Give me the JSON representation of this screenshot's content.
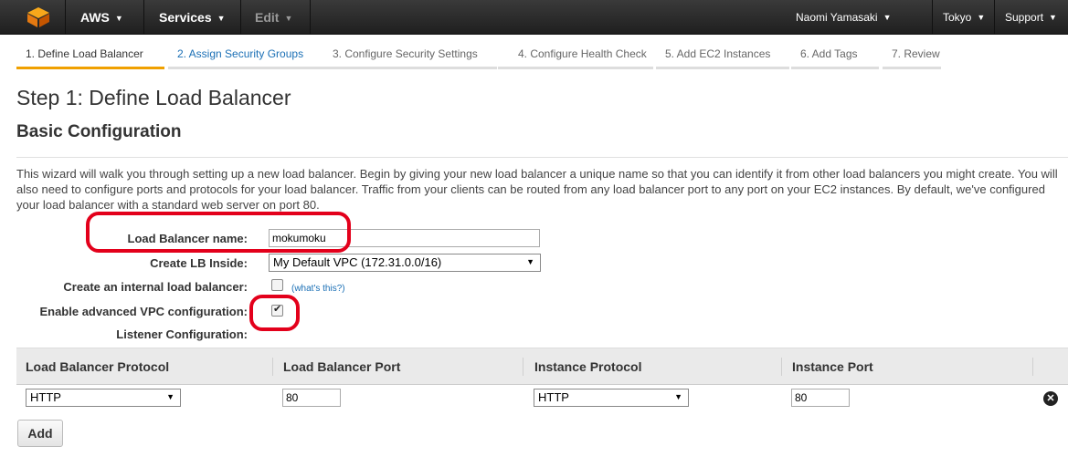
{
  "topbar": {
    "aws_label": "AWS",
    "services_label": "Services",
    "edit_label": "Edit",
    "user_label": "Naomi Yamasaki",
    "region_label": "Tokyo",
    "support_label": "Support"
  },
  "steps": [
    {
      "label": "1. Define Load Balancer"
    },
    {
      "label": "2. Assign Security Groups"
    },
    {
      "label": "3. Configure Security Settings"
    },
    {
      "label": "4. Configure Health Check"
    },
    {
      "label": "5. Add EC2 Instances"
    },
    {
      "label": "6. Add Tags"
    },
    {
      "label": "7. Review"
    }
  ],
  "page": {
    "title": "Step 1: Define Load Balancer",
    "subtitle": "Basic Configuration",
    "description": "This wizard will walk you through setting up a new load balancer. Begin by giving your new load balancer a unique name so that you can identify it from other load balancers you might create. You will also need to configure ports and protocols for your load balancer. Traffic from your clients can be routed from any load balancer port to any port on your EC2 instances. By default, we've configured your load balancer with a standard web server on port 80."
  },
  "form": {
    "name_label": "Load Balancer name:",
    "name_value": "mokumoku",
    "lb_inside_label": "Create LB Inside:",
    "lb_inside_value": "My Default VPC (172.31.0.0/16)",
    "internal_label": "Create an internal load balancer:",
    "internal_checked": false,
    "whats_this": "(what's this?)",
    "advanced_label": "Enable advanced VPC configuration:",
    "advanced_checked": true,
    "listener_label": "Listener Configuration:"
  },
  "listener_table": {
    "headers": [
      "Load Balancer Protocol",
      "Load Balancer Port",
      "Instance Protocol",
      "Instance Port"
    ],
    "rows": [
      {
        "lb_protocol": "HTTP",
        "lb_port": "80",
        "instance_protocol": "HTTP",
        "instance_port": "80"
      }
    ],
    "add_label": "Add"
  },
  "colors": {
    "accent_orange": "#f0a000",
    "highlight_red": "#e3001b",
    "link_blue": "#1a6fb5"
  },
  "icons": [
    "aws-logo-icon",
    "chevron-down-icon",
    "remove-circle-icon",
    "checkmark-icon"
  ]
}
